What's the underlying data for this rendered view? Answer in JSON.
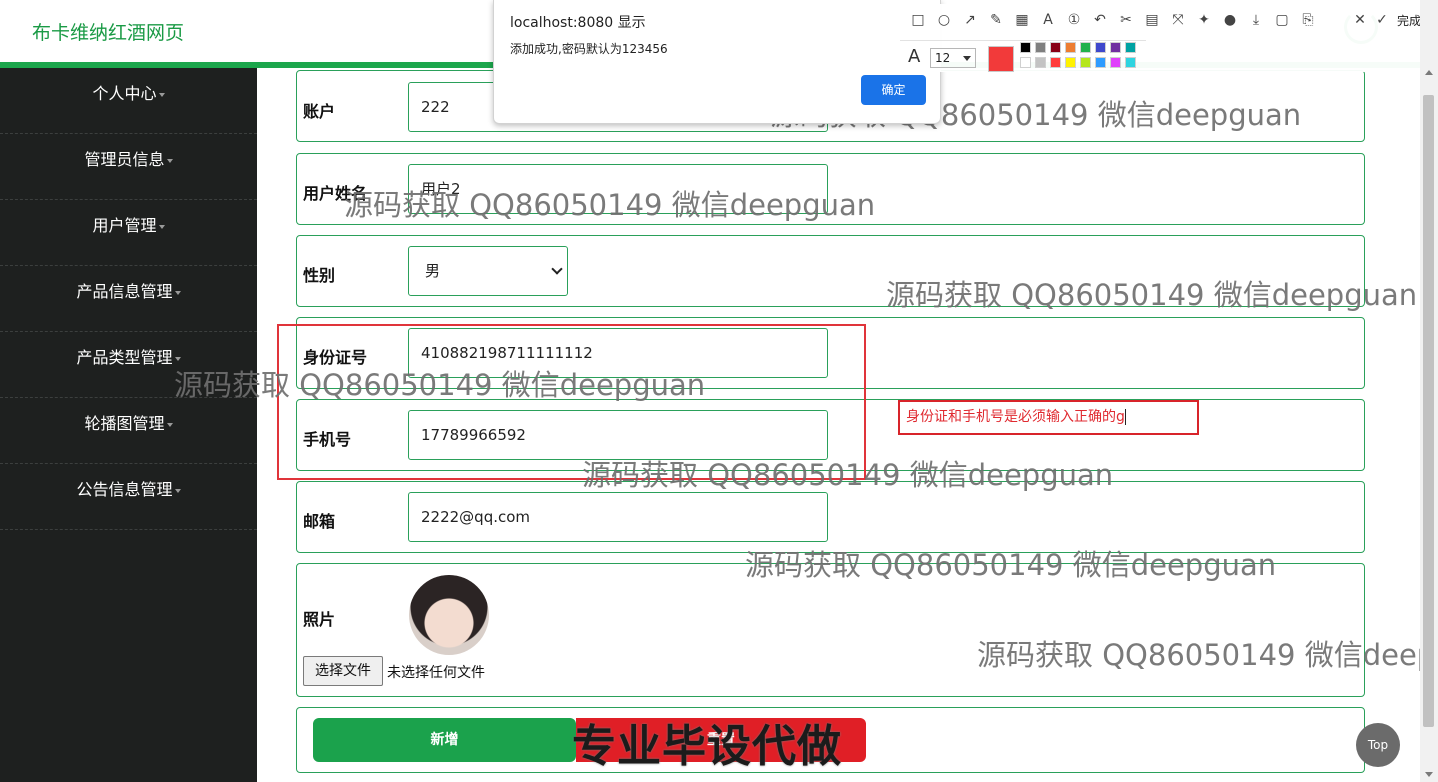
{
  "header": {
    "brand": "布卡维纳红酒网页"
  },
  "sidebar": {
    "items": [
      {
        "label": "个人中心"
      },
      {
        "label": "管理员信息"
      },
      {
        "label": "用户管理"
      },
      {
        "label": "产品信息管理"
      },
      {
        "label": "产品类型管理"
      },
      {
        "label": "轮播图管理"
      },
      {
        "label": "公告信息管理"
      }
    ]
  },
  "form": {
    "account": {
      "label": "账户",
      "value": "222"
    },
    "username": {
      "label": "用户姓名",
      "value": "用户2"
    },
    "gender": {
      "label": "性别",
      "value": "男"
    },
    "id_number": {
      "label": "身份证号",
      "value": "410882198711111112"
    },
    "phone": {
      "label": "手机号",
      "value": "17789966592"
    },
    "email": {
      "label": "邮箱",
      "value": "2222@qq.com"
    },
    "photo": {
      "label": "照片",
      "choose_button": "选择文件",
      "no_file": "未选择任何文件"
    },
    "submit_label": "新增",
    "reset_label": "重置"
  },
  "annotation": {
    "note": "身份证和手机号是必须输入正确的g",
    "banner": "专业毕设代做",
    "color_outline": "#e0343a"
  },
  "dialog": {
    "title": "localhost:8080 显示",
    "message": "添加成功,密码默认为123456",
    "ok_label": "确定"
  },
  "toolbar": {
    "font_size": "12",
    "done_label": "完成",
    "current_color": "#f23a3a",
    "palette": [
      "#000000",
      "#7f7f7f",
      "#880015",
      "#ed7d31",
      "#22b14c",
      "#3f48cc",
      "#7030a0",
      "#00a2a2",
      "#ffffff",
      "#c3c3c3",
      "#ff3b3b",
      "#fff200",
      "#b5e61d",
      "#2e9bff",
      "#e040fb",
      "#2fd4e0"
    ]
  },
  "watermark": "源码获取 QQ86050149 微信deepguan",
  "back_to_top": "Top"
}
